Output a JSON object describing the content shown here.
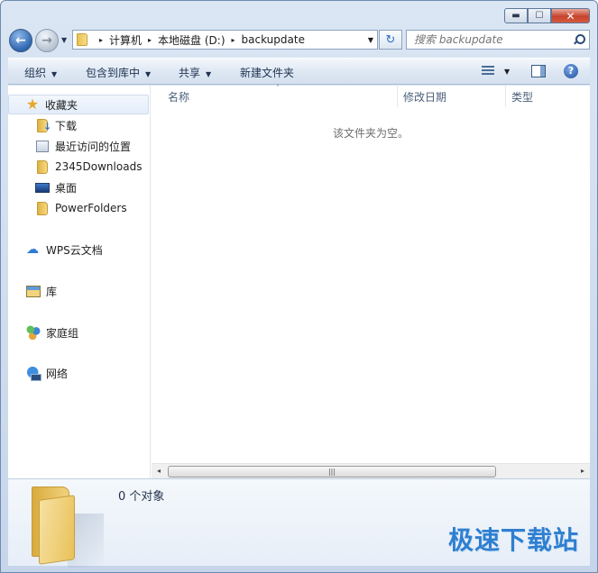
{
  "window": {
    "minimize": "▬",
    "maximize": "☐",
    "close": "✕"
  },
  "nav": {
    "back_glyph": "←",
    "forward_glyph": "→",
    "history_glyph": "▼",
    "refresh_glyph": "↻"
  },
  "address": {
    "crumbs": [
      "计算机",
      "本地磁盘 (D:)",
      "backupdate"
    ],
    "separator": "▸",
    "dropdown_glyph": "▼"
  },
  "search": {
    "placeholder": "搜索 backupdate"
  },
  "toolbar": {
    "organize": "组织",
    "include_in_library": "包含到库中",
    "share": "共享",
    "new_folder": "新建文件夹",
    "arrow_glyph": "▼",
    "help_glyph": "?"
  },
  "sidebar": {
    "favorites": "收藏夹",
    "favorites_items": [
      "下载",
      "最近访问的位置",
      "2345Downloads",
      "桌面",
      "PowerFolders"
    ],
    "wps": "WPS云文档",
    "library": "库",
    "homegroup": "家庭组",
    "network": "网络"
  },
  "filelist": {
    "columns": [
      "名称",
      "修改日期",
      "类型"
    ],
    "sort_glyph": "˄",
    "empty_message": "该文件夹为空。"
  },
  "scrollbar": {
    "left_glyph": "◂",
    "right_glyph": "▸",
    "grip": "|||"
  },
  "details": {
    "object_count": "0 个对象"
  },
  "watermark": "极速下载站"
}
